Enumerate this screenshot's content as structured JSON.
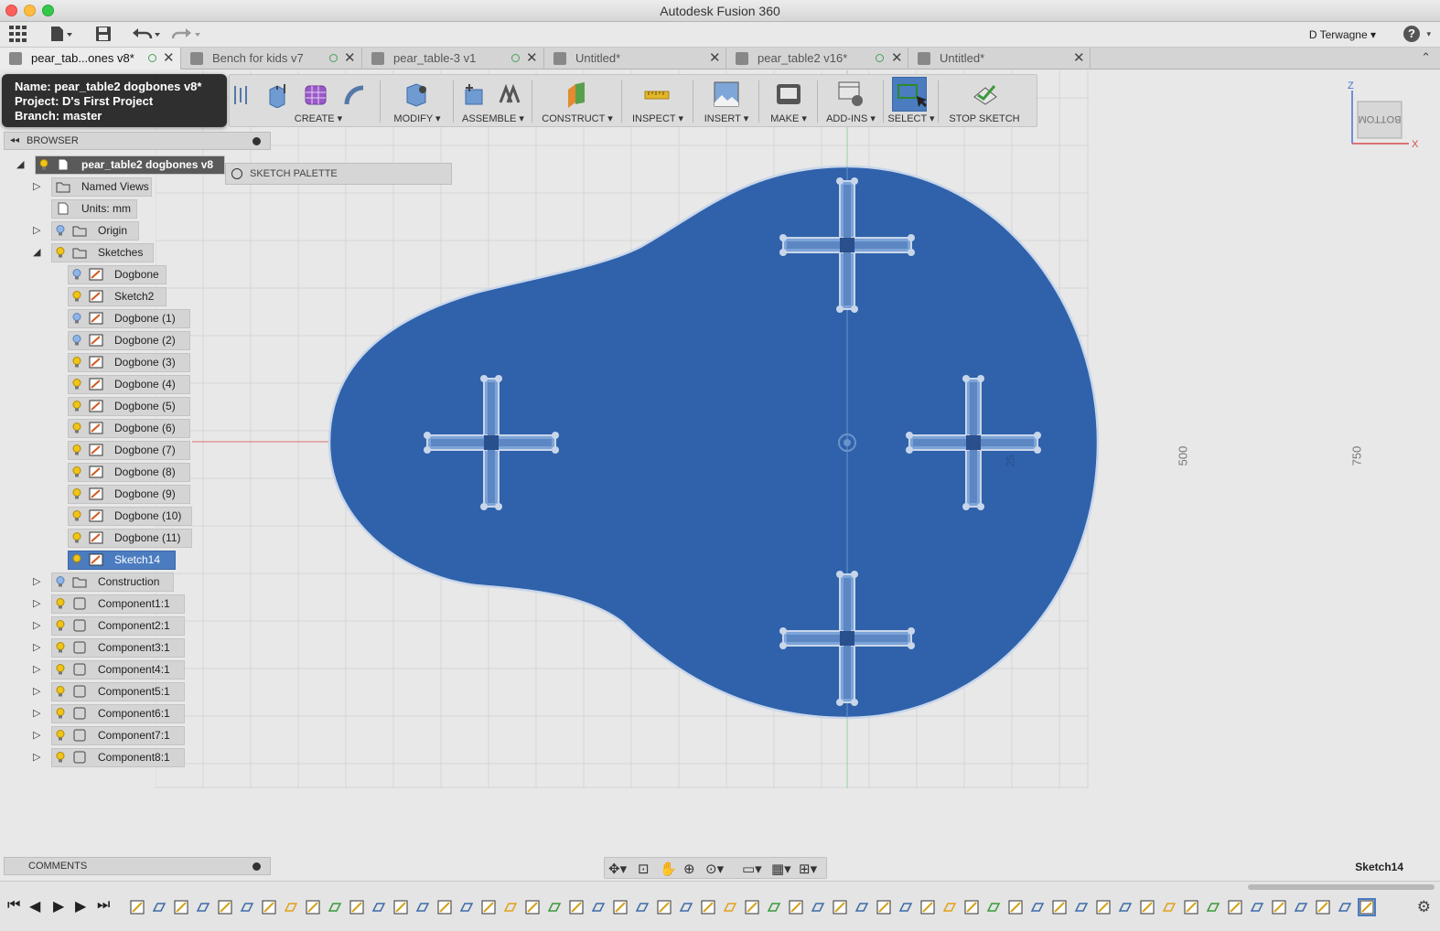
{
  "window": {
    "title": "Autodesk Fusion 360"
  },
  "app_toolbar": {
    "user": "D Terwagne ▾"
  },
  "tabs": [
    {
      "label": "pear_tab...ones v8*",
      "active": true
    },
    {
      "label": "Bench for kids v7",
      "active": false
    },
    {
      "label": "pear_table-3 v1",
      "active": false
    },
    {
      "label": "Untitled*",
      "active": false
    },
    {
      "label": "pear_table2 v16*",
      "active": false
    },
    {
      "label": "Untitled*",
      "active": false
    }
  ],
  "tooltip": {
    "name": "Name: pear_table2 dogbones v8*",
    "project": "Project: D's First Project",
    "branch": "Branch: master"
  },
  "ribbon": {
    "create": "CREATE ▾",
    "modify": "MODIFY ▾",
    "assemble": "ASSEMBLE ▾",
    "construct": "CONSTRUCT ▾",
    "inspect": "INSPECT ▾",
    "insert": "INSERT ▾",
    "make": "MAKE ▾",
    "addins": "ADD-INS ▾",
    "select": "SELECT ▾",
    "stop_sketch": "STOP SKETCH"
  },
  "browser": {
    "title": "BROWSER",
    "root": "pear_table2 dogbones v8",
    "named_views": "Named Views",
    "units": "Units: mm",
    "origin": "Origin",
    "sketches": "Sketches",
    "sketch_items": [
      "Dogbone",
      "Sketch2",
      "Dogbone (1)",
      "Dogbone (2)",
      "Dogbone (3)",
      "Dogbone (4)",
      "Dogbone (5)",
      "Dogbone (6)",
      "Dogbone (7)",
      "Dogbone (8)",
      "Dogbone (9)",
      "Dogbone (10)",
      "Dogbone (11)",
      "Sketch14"
    ],
    "construction": "Construction",
    "components": [
      "Component1:1",
      "Component2:1",
      "Component3:1",
      "Component4:1",
      "Component5:1",
      "Component6:1",
      "Component7:1",
      "Component8:1"
    ]
  },
  "sketch_palette": {
    "label": "SKETCH PALETTE"
  },
  "viewcube": {
    "face": "BOTTOM",
    "z": "Z",
    "x": "X"
  },
  "dimensions": {
    "d1": "500",
    "d2": "750",
    "d3": "25"
  },
  "comments": {
    "label": "COMMENTS"
  },
  "status": {
    "active_sketch": "Sketch14"
  },
  "colors": {
    "shape_fill": "#2f62ab",
    "shape_edge": "#c9d6ea",
    "selection": "#4b7cc0",
    "ribbon_bg": "#dcdcdc"
  }
}
